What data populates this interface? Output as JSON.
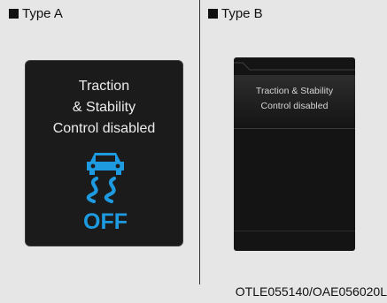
{
  "type_a": {
    "label": "Type A",
    "text_lines": [
      "Traction",
      "& Stability",
      "Control disabled"
    ],
    "icon": "traction-control-off-icon",
    "icon_text": "OFF",
    "icon_color": "#1e9be0"
  },
  "type_b": {
    "label": "Type B",
    "text_lines": [
      "Traction & Stability",
      "Control disabled"
    ]
  },
  "caption": "OTLE055140/OAE056020L"
}
